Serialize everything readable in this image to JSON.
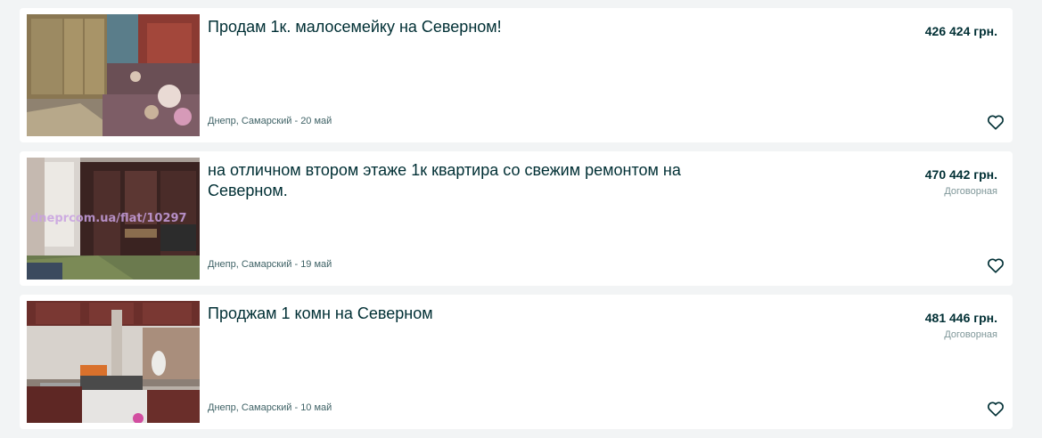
{
  "listings": [
    {
      "title": "Продам 1к. малосемейку на Северном!",
      "location": "Днепр, Самарский - 20 май",
      "price": "426 424 грн.",
      "negotiable": "",
      "photo": "living-room-photo"
    },
    {
      "title": "на отличном втором этаже 1к квартира со свежим ремонтом на Северном.",
      "location": "Днепр, Самарский - 19 май",
      "price": "470 442 грн.",
      "negotiable": "Договорная",
      "photo": "room-with-cabinet-photo",
      "watermark": "dneprcom.ua/flat/10297"
    },
    {
      "title": "Проджам 1 комн на Северном",
      "location": "Днепр, Самарский - 10 май",
      "price": "481 446 грн.",
      "negotiable": "Договорная",
      "photo": "kitchen-photo"
    }
  ],
  "icons": {
    "favorite": "heart-icon"
  },
  "colors": {
    "background": "#f2f4f5",
    "card": "#ffffff",
    "text_primary": "#002f34",
    "text_secondary": "#406367",
    "text_muted": "#7f9799"
  }
}
